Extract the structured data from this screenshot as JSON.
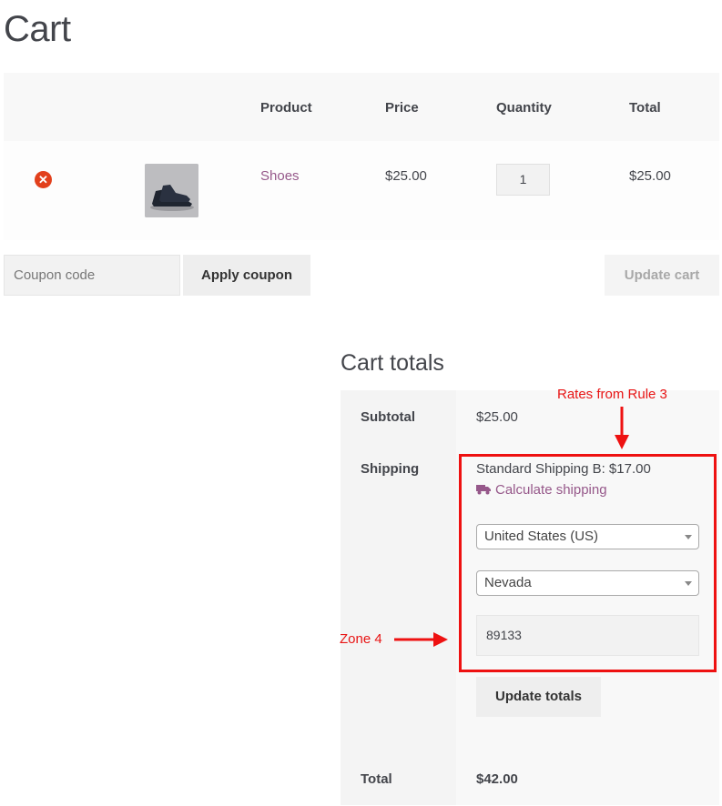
{
  "page": {
    "title": "Cart"
  },
  "cart_table": {
    "headers": {
      "product": "Product",
      "price": "Price",
      "quantity": "Quantity",
      "total": "Total"
    },
    "rows": [
      {
        "remove_icon": "close-circle-icon",
        "thumbnail": "shoes-thumbnail",
        "product": "Shoes",
        "price": "$25.00",
        "quantity": "1",
        "total": "$25.00"
      }
    ]
  },
  "coupon": {
    "placeholder": "Coupon code",
    "apply_label": "Apply coupon"
  },
  "update_cart_label": "Update cart",
  "totals": {
    "title": "Cart totals",
    "subtotal_label": "Subtotal",
    "subtotal_value": "$25.00",
    "shipping_label": "Shipping",
    "shipping_value": "Standard Shipping B: $17.00",
    "calculate_shipping": "Calculate shipping",
    "country": "United States (US)",
    "state": "Nevada",
    "postcode": "89133",
    "update_totals_label": "Update totals",
    "total_label": "Total",
    "total_value": "$42.00"
  },
  "annotations": {
    "rates_note": "Rates from Rule 3",
    "zone_note": "Zone 4"
  },
  "colors": {
    "link": "#96588a",
    "remove": "#e2401c",
    "annotation": "#ee1111"
  }
}
